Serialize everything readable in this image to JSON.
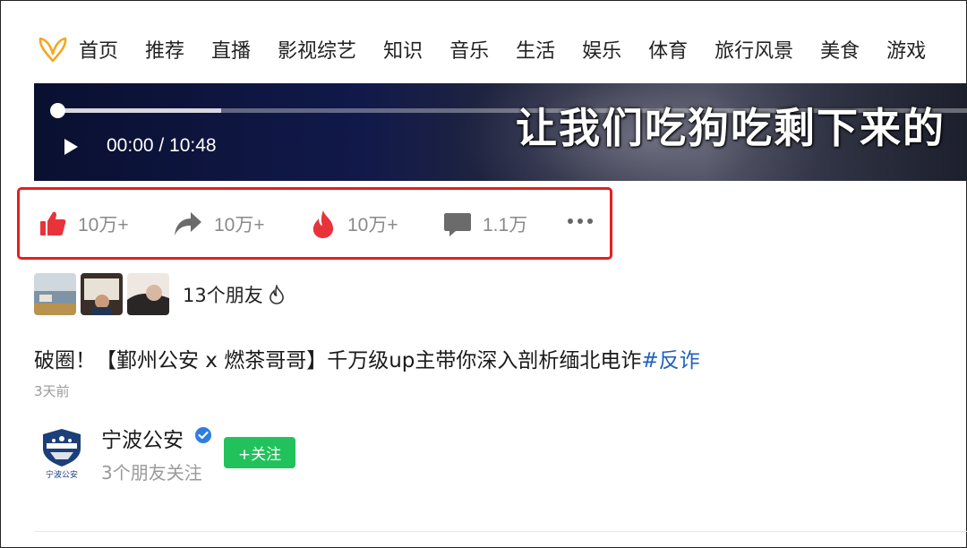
{
  "nav": {
    "items": [
      "首页",
      "推荐",
      "直播",
      "影视综艺",
      "知识",
      "音乐",
      "生活",
      "娱乐",
      "体育",
      "旅行风景",
      "美食",
      "游戏"
    ],
    "logo_icon": "butterfly-logo-icon",
    "logo_color": "#f5a623"
  },
  "video": {
    "time": "00:00 / 10:48",
    "subtitle": "让我们吃狗吃剩下来的",
    "buffered_fraction": 0.18,
    "played_fraction": 0.0
  },
  "actions": {
    "like_count": "10万+",
    "share_count": "10万+",
    "hot_count": "10万+",
    "comment_count": "1.1万",
    "icons": [
      "thumbs-up-icon",
      "share-arrow-icon",
      "fire-icon",
      "comment-icon",
      "more-icon"
    ],
    "accent_color": "#e8333a",
    "highlight_color": "#e61e1e"
  },
  "friends": {
    "text": "13个朋友"
  },
  "post": {
    "title": "破圈！【鄞州公安 x 燃茶哥哥】千万级up主带你深入剖析缅北电诈",
    "hashtag": "#反诈",
    "date": "3天前"
  },
  "author": {
    "name": "宁波公安",
    "sub": "3个朋友关注",
    "follow_label": "+关注",
    "avatar_caption": "宁波公安",
    "follow_color": "#21c25b"
  }
}
